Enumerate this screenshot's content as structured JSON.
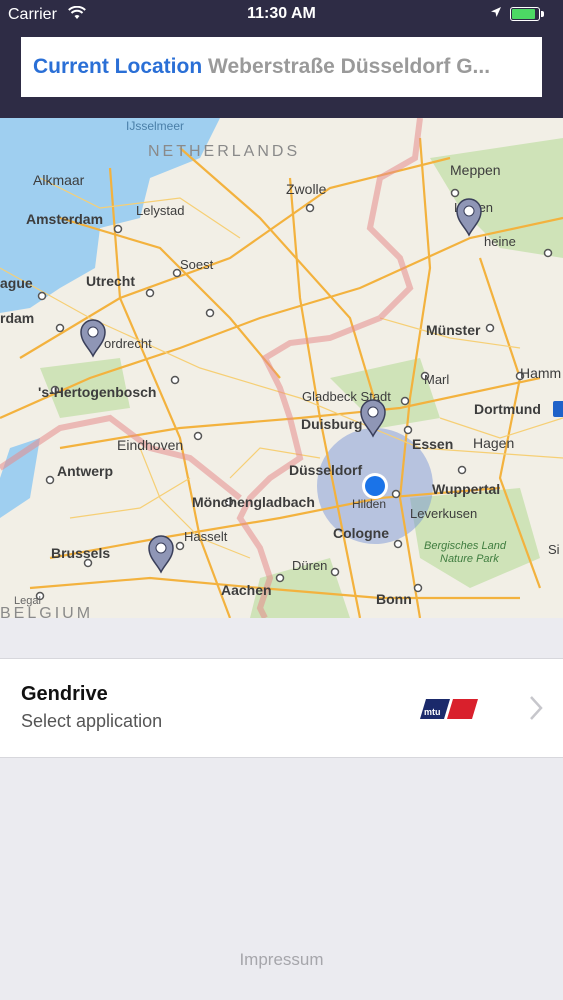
{
  "status_bar": {
    "carrier": "Carrier",
    "time": "11:30 AM",
    "battery_level": 0.9,
    "battery_color": "#4cd964"
  },
  "header": {
    "location_label": "Current Location",
    "location_value": "Weberstraße Düsseldorf G..."
  },
  "map": {
    "labels": {
      "ijsselmeer": "IJsselmeer",
      "netherlands": "NETHERLANDS",
      "alkmaar": "Alkmaar",
      "meppen": "Meppen",
      "zwolle": "Zwolle",
      "amsterdam": "Amsterdam",
      "lelystad": "Lelystad",
      "lingen": "Lingen",
      "rheine": "heine",
      "soest": "Soest",
      "utrecht": "Utrecht",
      "hague": "ague",
      "rotterdam": "rdam",
      "dordrecht": "ordrecht",
      "munster": "Münster",
      "marl": "Marl",
      "hertogenbosch": "'s-Hertogenbosch",
      "gladbeck": "Gladbeck Stadt",
      "hamm": "Hamm",
      "dortmund": "Dortmund",
      "duisburg": "Duisburg",
      "eindhoven": "Eindhoven",
      "essen": "Essen",
      "hagen": "Hagen",
      "antwerp": "Antwerp",
      "dusseldorf": "Düsseldorf",
      "wuppertal": "Wuppertal",
      "monchengladbach": "Mönchengladbach",
      "hilden": "Hilden",
      "leverkusen": "Leverkusen",
      "hasselt": "Hasselt",
      "cologne": "Cologne",
      "bergisches": "Bergisches Land",
      "naturepark": "Nature Park",
      "brussels": "Brussels",
      "duren": "Düren",
      "aachen": "Aachen",
      "bonn": "Bonn",
      "belgium": "BELGIUM",
      "legal": "Legal",
      "si": "Si"
    }
  },
  "list": {
    "items": [
      {
        "title": "Gendrive",
        "subtitle": "Select application",
        "brand": "mtu"
      }
    ]
  },
  "footer": {
    "impressum": "Impressum"
  },
  "colors": {
    "header_bg": "#2e2c45",
    "accent": "#2a6fd6",
    "user_location": "#1a73e8",
    "brand_red": "#d9202c",
    "brand_blue": "#1b2a6b"
  }
}
